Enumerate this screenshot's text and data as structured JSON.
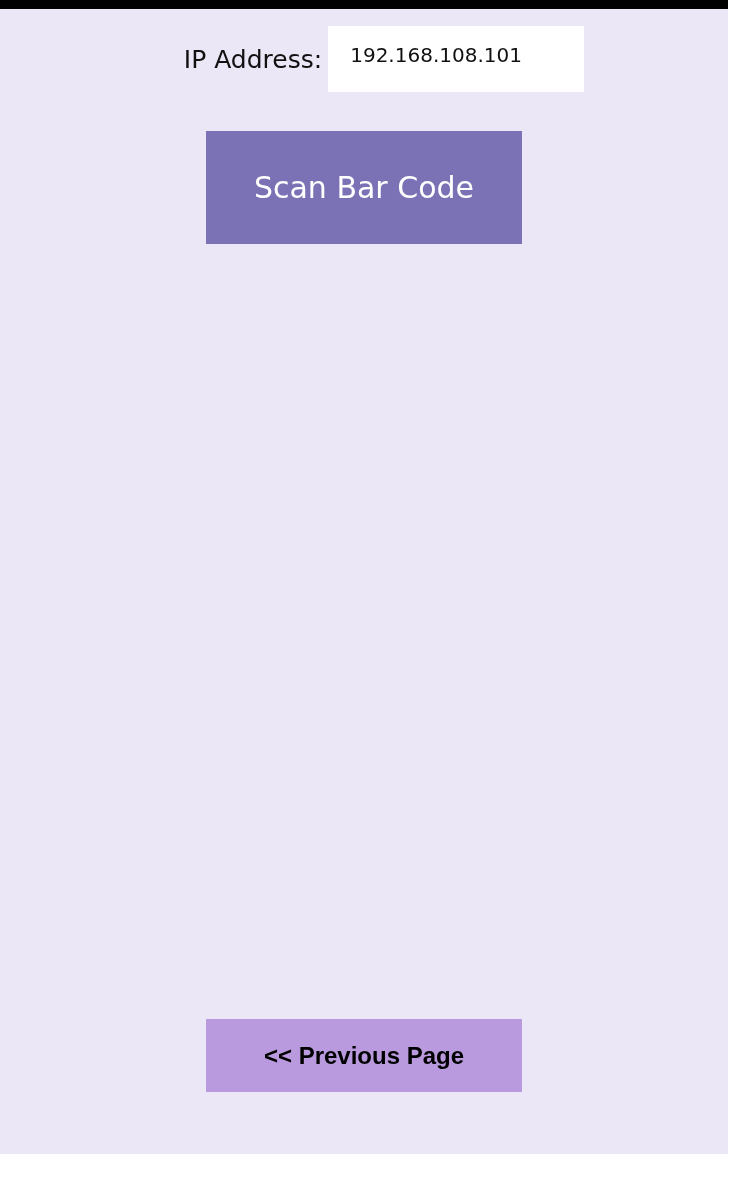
{
  "ip_field": {
    "label": "IP Address:",
    "value": "192.168.108.101"
  },
  "scan_button": {
    "label": "Scan Bar Code"
  },
  "previous_button": {
    "label": "<< Previous Page"
  }
}
